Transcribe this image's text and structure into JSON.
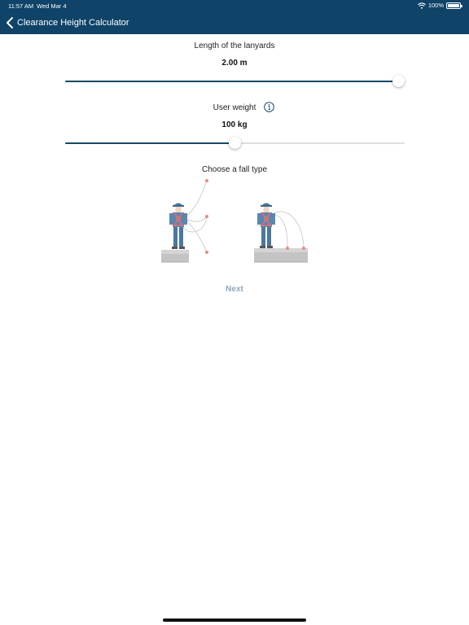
{
  "status_bar": {
    "time": "11:57 AM",
    "date": "Wed Mar 4",
    "battery": "100%"
  },
  "nav": {
    "title": "Clearance Height Calculator"
  },
  "lanyard": {
    "label": "Length of the lanyards",
    "value": "2.00 m",
    "fraction": 1.0
  },
  "weight": {
    "label": "User weight",
    "value": "100 kg",
    "fraction": 0.5
  },
  "fall": {
    "title": "Choose a fall type"
  },
  "next_label": "Next",
  "colors": {
    "nav_bg": "#0f4368",
    "slider_fill": "#174866",
    "harness": "#e0706b",
    "next": "#8ea7bd"
  }
}
